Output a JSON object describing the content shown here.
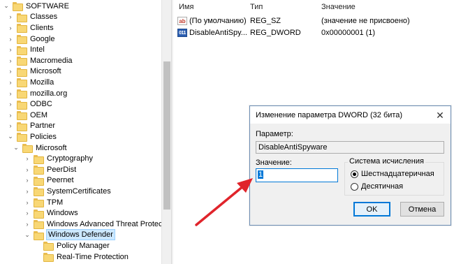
{
  "tree": {
    "items": [
      {
        "label": "SOFTWARE",
        "level": 0,
        "expander": "⌄"
      },
      {
        "label": "Classes",
        "level": 1,
        "expander": "›"
      },
      {
        "label": "Clients",
        "level": 1,
        "expander": "›"
      },
      {
        "label": "Google",
        "level": 1,
        "expander": "›"
      },
      {
        "label": "Intel",
        "level": 1,
        "expander": "›"
      },
      {
        "label": "Macromedia",
        "level": 1,
        "expander": "›"
      },
      {
        "label": "Microsoft",
        "level": 1,
        "expander": "›"
      },
      {
        "label": "Mozilla",
        "level": 1,
        "expander": "›"
      },
      {
        "label": "mozilla.org",
        "level": 1,
        "expander": "›"
      },
      {
        "label": "ODBC",
        "level": 1,
        "expander": "›"
      },
      {
        "label": "OEM",
        "level": 1,
        "expander": "›"
      },
      {
        "label": "Partner",
        "level": 1,
        "expander": "›"
      },
      {
        "label": "Policies",
        "level": 1,
        "expander": "⌄"
      },
      {
        "label": "Microsoft",
        "level": 2,
        "expander": "⌄"
      },
      {
        "label": "Cryptography",
        "level": 3,
        "expander": "›"
      },
      {
        "label": "PeerDist",
        "level": 3,
        "expander": "›"
      },
      {
        "label": "Peernet",
        "level": 3,
        "expander": "›"
      },
      {
        "label": "SystemCertificates",
        "level": 3,
        "expander": "›"
      },
      {
        "label": "TPM",
        "level": 3,
        "expander": "›"
      },
      {
        "label": "Windows",
        "level": 3,
        "expander": "›"
      },
      {
        "label": "Windows Advanced Threat Protectio",
        "level": 3,
        "expander": "›"
      },
      {
        "label": "Windows Defender",
        "level": 3,
        "expander": "⌄",
        "selected": true
      },
      {
        "label": "Policy Manager",
        "level": 4,
        "expander": ""
      },
      {
        "label": "Real-Time Protection",
        "level": 4,
        "expander": ""
      }
    ]
  },
  "values": {
    "columns": {
      "name": "Имя",
      "type": "Тип",
      "value": "Значение"
    },
    "rows": [
      {
        "icon": "ab",
        "icon_name": "string-value-icon",
        "name": "(По умолчанию)",
        "type": "REG_SZ",
        "value": "(значение не присвоено)"
      },
      {
        "icon": "011",
        "icon_name": "dword-value-icon",
        "name": "DisableAntiSpy...",
        "type": "REG_DWORD",
        "value": "0x00000001 (1)"
      }
    ]
  },
  "dialog": {
    "title": "Изменение параметра DWORD (32 бита)",
    "close": "✕",
    "param_label": "Параметр:",
    "param_value": "DisableAntiSpyware",
    "value_label": "Значение:",
    "value": "1",
    "base_group": "Система исчисления",
    "base_hex": "Шестнадцатеричная",
    "base_dec": "Десятичная",
    "base_selected": "hex",
    "ok": "OK",
    "cancel": "Отмена"
  },
  "colors": {
    "arrow": "#e0242b",
    "selection": "#cce8ff",
    "accent": "#0078d7"
  }
}
